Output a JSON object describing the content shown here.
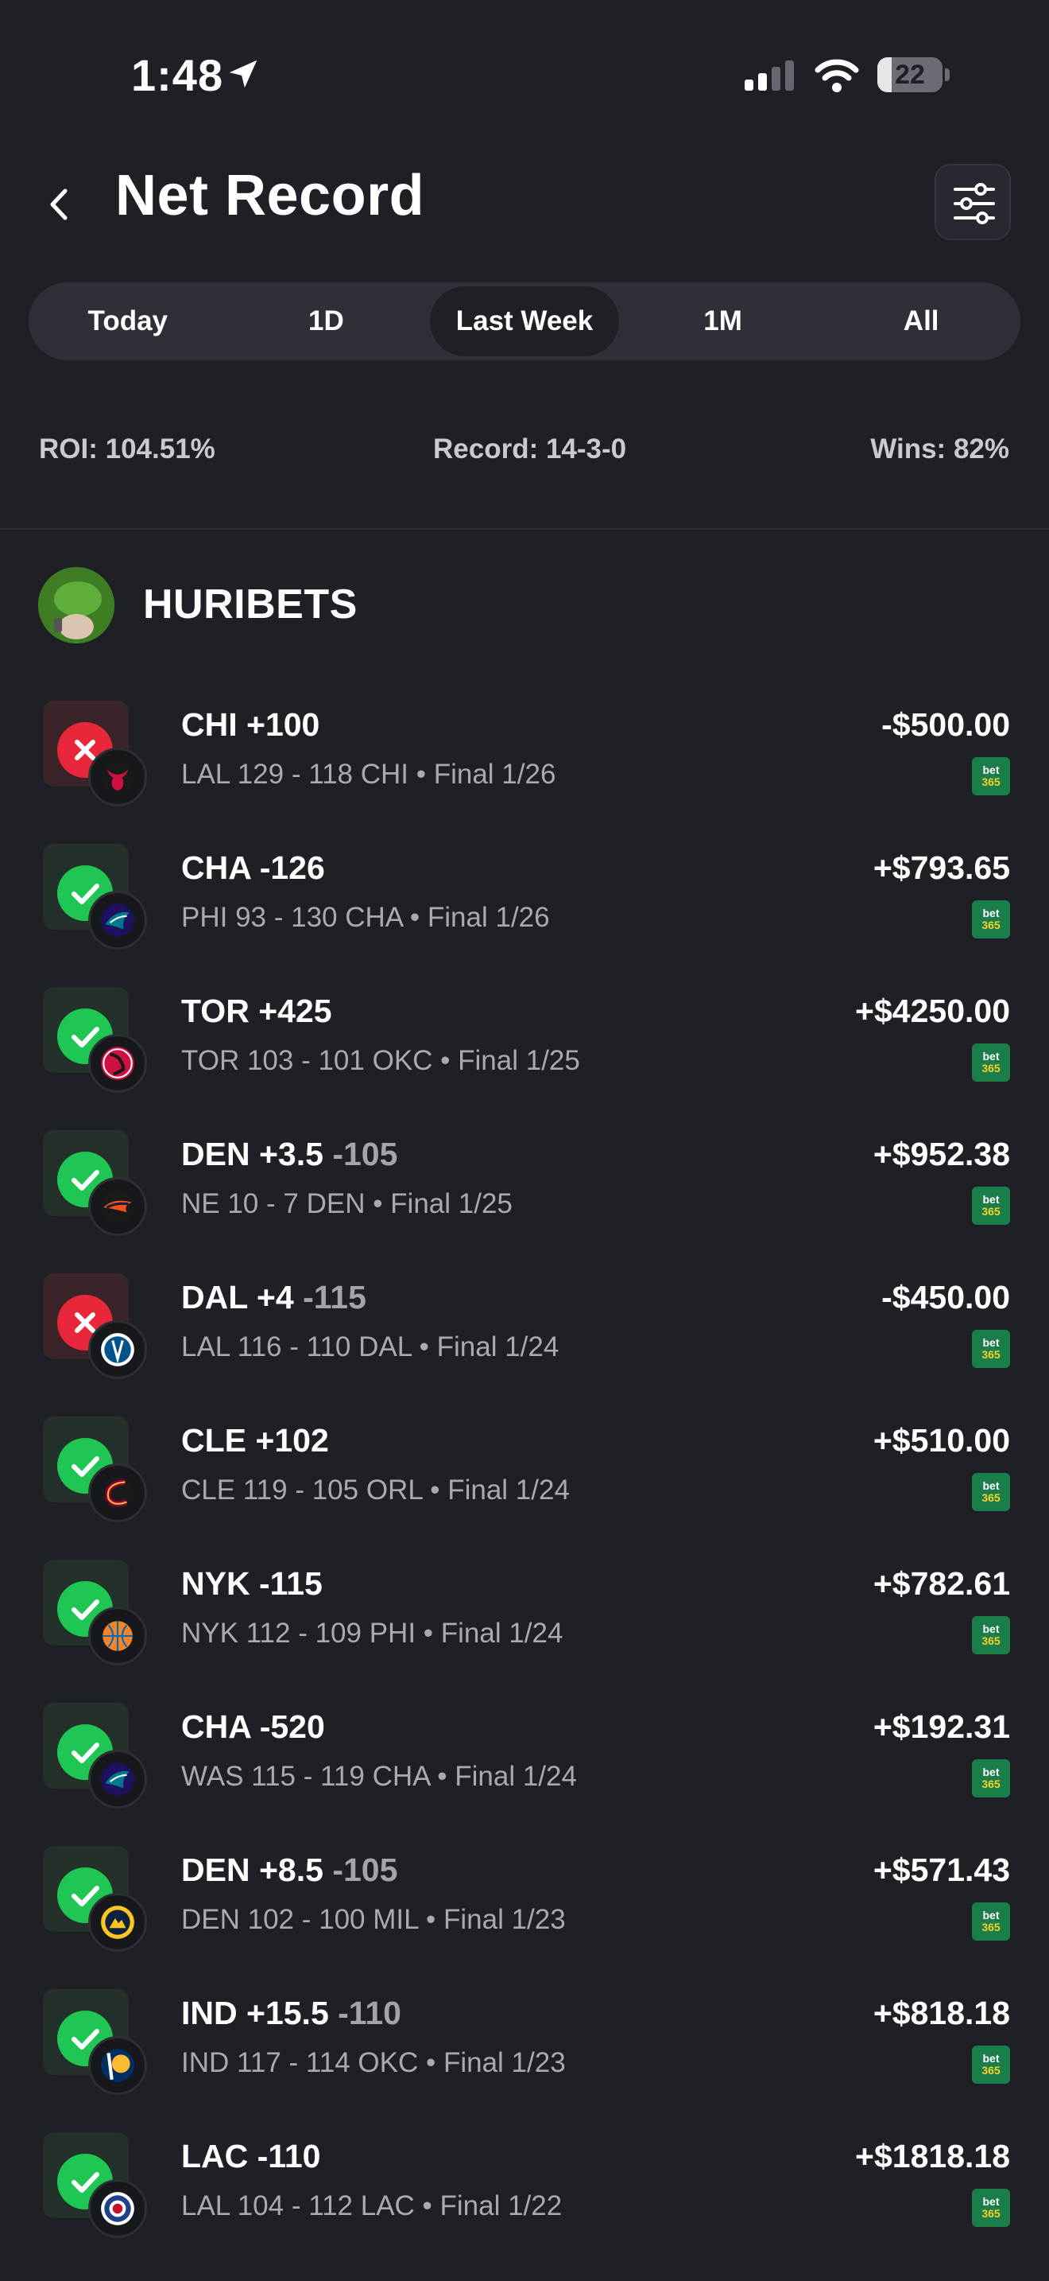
{
  "status_bar": {
    "time": "1:48",
    "battery": "22"
  },
  "header": {
    "title": "Net Record"
  },
  "tabs": [
    {
      "label": "Today",
      "active": false
    },
    {
      "label": "1D",
      "active": false
    },
    {
      "label": "Last Week",
      "active": true
    },
    {
      "label": "1M",
      "active": false
    },
    {
      "label": "All",
      "active": false
    }
  ],
  "stats": {
    "roi": "ROI: 104.51%",
    "record": "Record: 14-3-0",
    "wins": "Wins: 82%"
  },
  "user": {
    "name": "HURIBETS"
  },
  "book_label": {
    "top": "bet",
    "bottom": "365"
  },
  "bets": [
    {
      "result": "loss",
      "team": "bulls",
      "pick": "CHI +100",
      "odds": "",
      "line": "LAL 129 - 118 CHI • Final 1/26",
      "amount": "-$500.00"
    },
    {
      "result": "win",
      "team": "hornets",
      "pick": "CHA -126",
      "odds": "",
      "line": "PHI 93 - 130 CHA • Final 1/26",
      "amount": "+$793.65"
    },
    {
      "result": "win",
      "team": "raptors",
      "pick": "TOR +425",
      "odds": "",
      "line": "TOR 103 - 101 OKC • Final 1/25",
      "amount": "+$4250.00"
    },
    {
      "result": "win",
      "team": "broncos",
      "pick": "DEN +3.5",
      "odds": "-105",
      "line": "NE 10 - 7 DEN • Final 1/25",
      "amount": "+$952.38"
    },
    {
      "result": "loss",
      "team": "mavericks",
      "pick": "DAL +4",
      "odds": "-115",
      "line": "LAL 116 - 110 DAL • Final 1/24",
      "amount": "-$450.00"
    },
    {
      "result": "win",
      "team": "cavaliers",
      "pick": "CLE +102",
      "odds": "",
      "line": "CLE 119 - 105 ORL • Final 1/24",
      "amount": "+$510.00"
    },
    {
      "result": "win",
      "team": "knicks",
      "pick": "NYK -115",
      "odds": "",
      "line": "NYK 112 - 109 PHI • Final 1/24",
      "amount": "+$782.61"
    },
    {
      "result": "win",
      "team": "hornets",
      "pick": "CHA -520",
      "odds": "",
      "line": "WAS 115 - 119 CHA • Final 1/24",
      "amount": "+$192.31"
    },
    {
      "result": "win",
      "team": "nuggets",
      "pick": "DEN +8.5",
      "odds": "-105",
      "line": "DEN 102 - 100 MIL • Final 1/23",
      "amount": "+$571.43"
    },
    {
      "result": "win",
      "team": "pacers",
      "pick": "IND +15.5",
      "odds": "-110",
      "line": "IND 117 - 114 OKC • Final 1/23",
      "amount": "+$818.18"
    },
    {
      "result": "win",
      "team": "clippers",
      "pick": "LAC -110",
      "odds": "",
      "line": "LAL 104 - 112 LAC • Final 1/22",
      "amount": "+$1818.18"
    }
  ],
  "colors": {
    "background": "#1f2026",
    "win": "#1fc653",
    "loss": "#e8283a",
    "bet365": "#1b7d4a"
  }
}
